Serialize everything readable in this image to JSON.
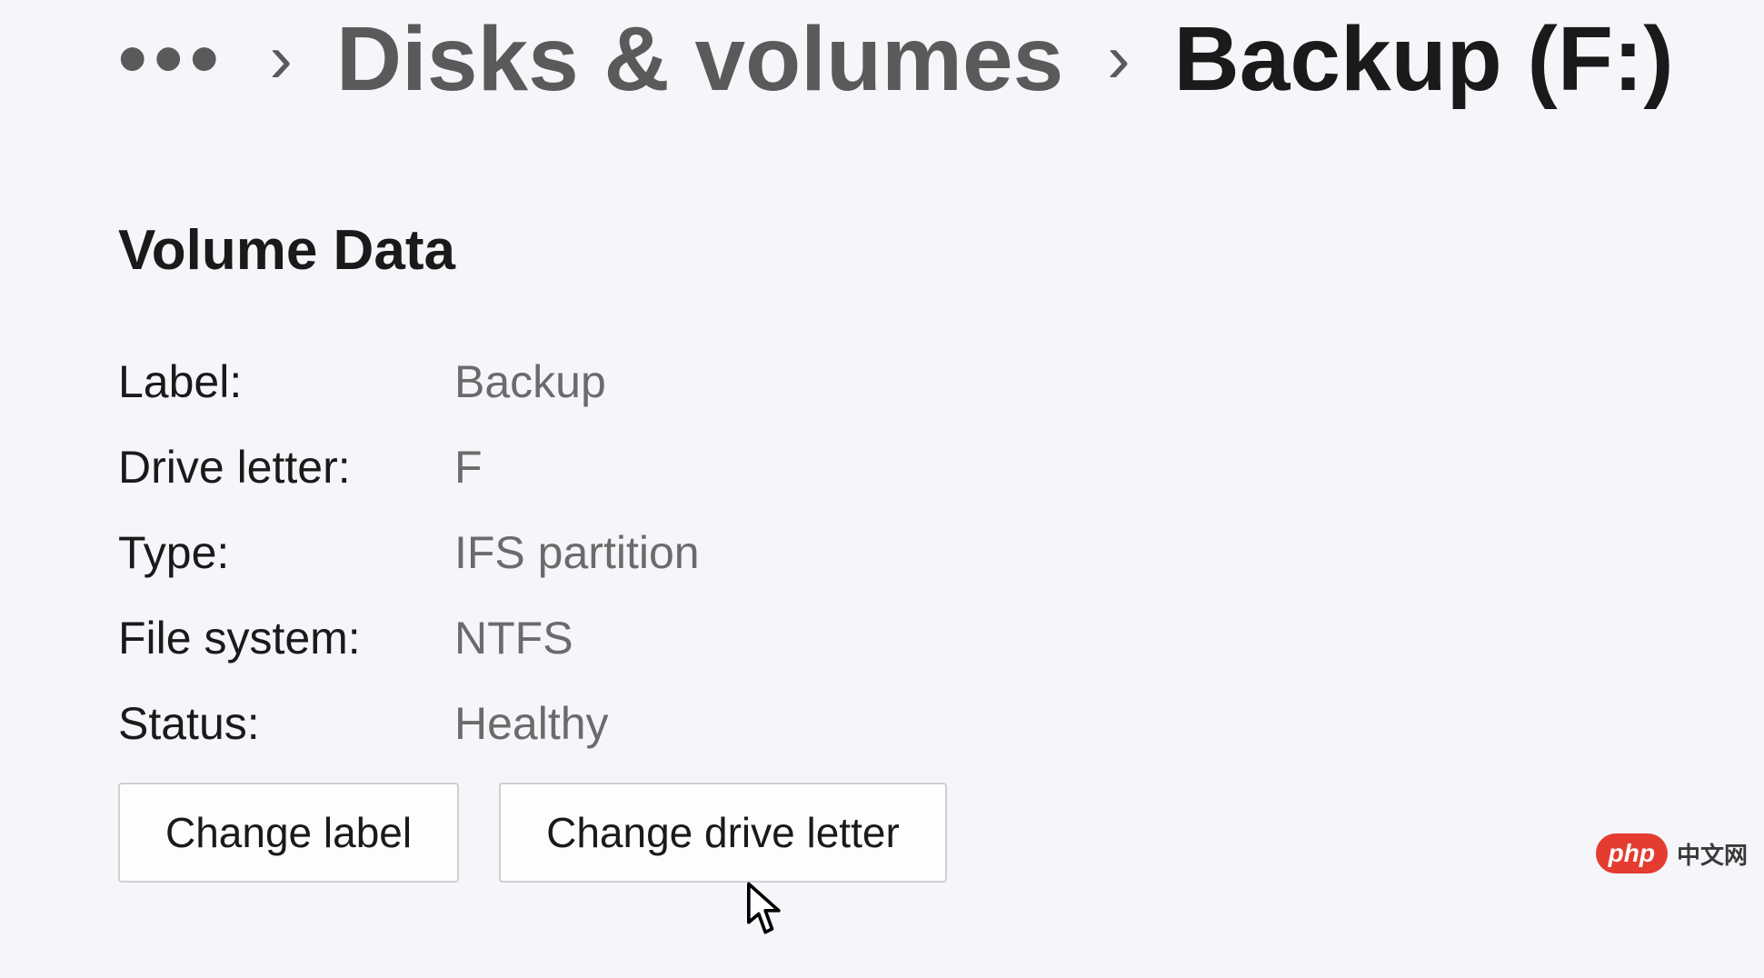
{
  "breadcrumb": {
    "ellipsis": "•••",
    "parent": "Disks & volumes",
    "current": "Backup (F:)"
  },
  "section": {
    "title": "Volume Data"
  },
  "volume": {
    "label_key": "Label:",
    "label_val": "Backup",
    "drive_letter_key": "Drive letter:",
    "drive_letter_val": "F",
    "type_key": "Type:",
    "type_val": "IFS partition",
    "filesystem_key": "File system:",
    "filesystem_val": "NTFS",
    "status_key": "Status:",
    "status_val": "Healthy"
  },
  "actions": {
    "change_label": "Change label",
    "change_drive_letter": "Change drive letter"
  },
  "watermark": {
    "logo": "php",
    "text": "中文网"
  }
}
